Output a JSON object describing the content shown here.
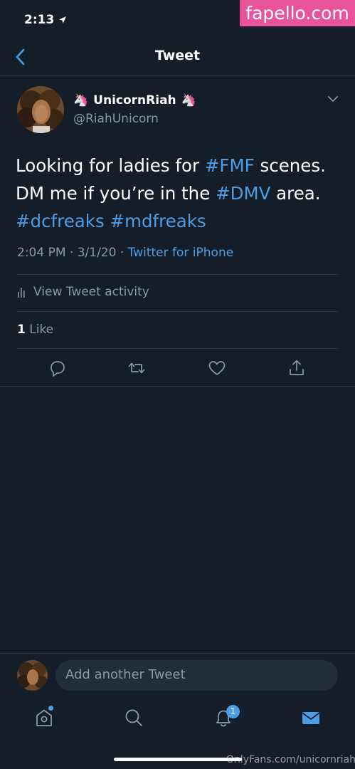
{
  "status_bar": {
    "time": "2:13",
    "location_icon": "location-arrow-icon"
  },
  "watermark_top": "fapello.com",
  "header": {
    "title": "Tweet",
    "back_icon": "chevron-left-icon"
  },
  "tweet": {
    "display_name": "UnicornRiah",
    "name_emoji": "🦄",
    "handle": "@RiahUnicorn",
    "text_parts": {
      "t1": "Looking for ladies for ",
      "h1": "#FMF",
      "t2": " scenes.",
      "t3": "DM me if you’re in the ",
      "h2": "#DMV",
      "t4": " area.",
      "h3": "#dcfreaks",
      "t5": " ",
      "h4": "#mdfreaks"
    },
    "timestamp": "2:04 PM · 3/1/20 · ",
    "source": "Twitter for iPhone",
    "activity_label": "View Tweet activity",
    "like_count": "1",
    "like_label": " Like"
  },
  "actions": [
    "reply-icon",
    "retweet-icon",
    "like-icon",
    "share-icon"
  ],
  "compose": {
    "placeholder": "Add another Tweet"
  },
  "tab_bar": {
    "items": [
      "home-icon",
      "search-icon",
      "notifications-icon",
      "messages-icon"
    ],
    "notification_badge": "1"
  },
  "watermark_bottom": "OnlyFans.com/unicornriah",
  "colors": {
    "background": "#151d29",
    "accent": "#4a9ee5",
    "muted": "#8899a6",
    "divider": "#2b3746",
    "watermark": "#e8549c"
  }
}
